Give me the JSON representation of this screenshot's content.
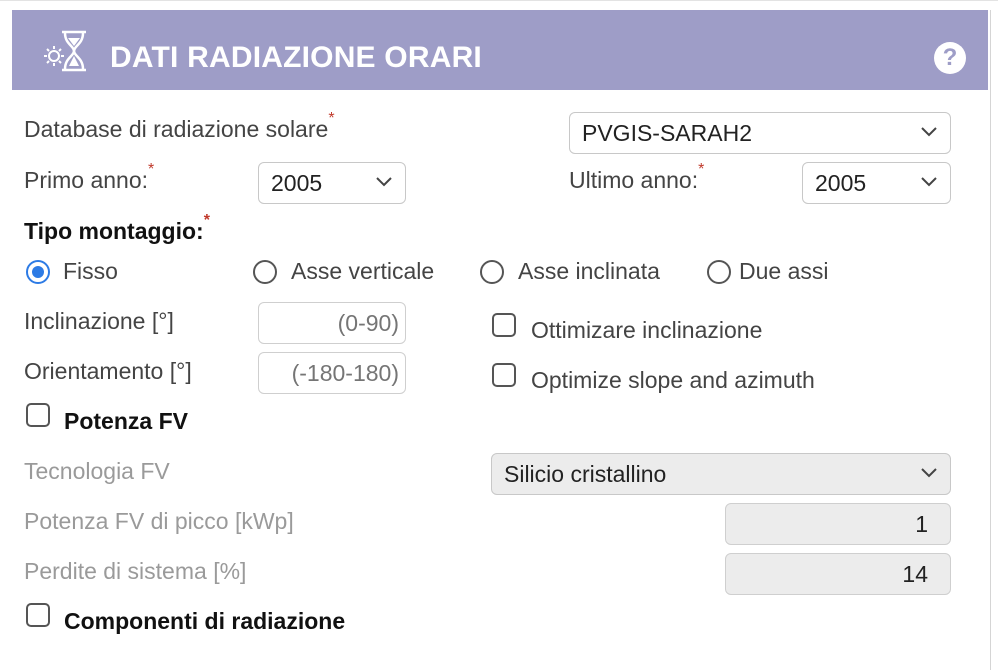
{
  "panel": {
    "title": "DATI RADIAZIONE ORARI",
    "help_label": "?"
  },
  "required_mark": "*",
  "database": {
    "label": "Database di radiazione solare",
    "value": "PVGIS-SARAH2"
  },
  "years": {
    "start_label": "Primo anno:",
    "start_value": "2005",
    "end_label": "Ultimo anno:",
    "end_value": "2005"
  },
  "mounting": {
    "label": "Tipo montaggio:",
    "options": [
      "Fisso",
      "Asse verticale",
      "Asse inclinata",
      "Due assi"
    ],
    "selected": "Fisso"
  },
  "slope": {
    "label": "Inclinazione [°]",
    "placeholder": "(0-90)",
    "optimize_label": "Ottimizare inclinazione"
  },
  "azimuth": {
    "label": "Orientamento [°]",
    "placeholder": "(-180-180)",
    "optimize_label": "Optimize slope and azimuth"
  },
  "pv_power": {
    "label": "Potenza FV",
    "checked": false,
    "technology_label": "Tecnologia FV",
    "technology_value": "Silicio cristallino",
    "peak_label": "Potenza FV di picco [kWp]",
    "peak_value": "1",
    "loss_label": "Perdite di sistema [%]",
    "loss_value": "14"
  },
  "components": {
    "label": "Componenti di radiazione",
    "checked": false
  },
  "icons": {
    "header": "hourglass-sun-icon",
    "help": "help-icon",
    "dropdown": "chevron-down-icon"
  },
  "colors": {
    "header_bg": "#9e9dc7",
    "radio_accent": "#2d7be5",
    "required": "#c0392b"
  }
}
